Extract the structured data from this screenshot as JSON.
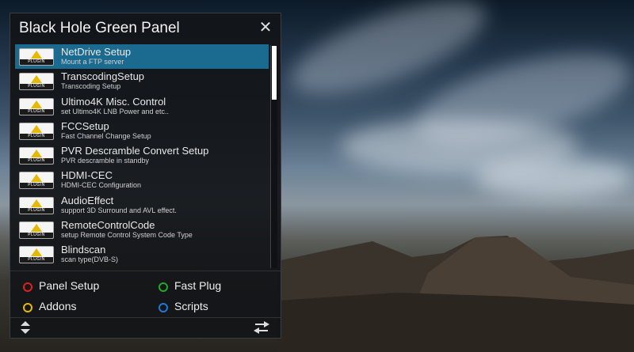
{
  "panel": {
    "title": "Black Hole Green Panel",
    "close_icon": "close-icon"
  },
  "items": [
    {
      "title": "NetDrive Setup",
      "subtitle": "Mount a FTP server",
      "selected": true
    },
    {
      "title": "TranscodingSetup",
      "subtitle": "Transcoding Setup",
      "selected": false
    },
    {
      "title": "Ultimo4K Misc. Control",
      "subtitle": "set Ultimo4K LNB Power and etc..",
      "selected": false
    },
    {
      "title": "FCCSetup",
      "subtitle": "Fast Channel Change Setup",
      "selected": false
    },
    {
      "title": "PVR Descramble Convert Setup",
      "subtitle": "PVR descramble in standby",
      "selected": false
    },
    {
      "title": "HDMI-CEC",
      "subtitle": "HDMI-CEC Configuration",
      "selected": false
    },
    {
      "title": "AudioEffect",
      "subtitle": "support 3D Surround and AVL effect.",
      "selected": false
    },
    {
      "title": "RemoteControlCode",
      "subtitle": "setup Remote Control System Code Type",
      "selected": false
    },
    {
      "title": "Blindscan",
      "subtitle": "scan type(DVB-S)",
      "selected": false
    }
  ],
  "plugin_icon_text": "PLUGIN",
  "legend": {
    "red": {
      "label": "Panel Setup",
      "color": "#e02020"
    },
    "green": {
      "label": "Fast Plug",
      "color": "#1faa2a"
    },
    "yellow": {
      "label": "Addons",
      "color": "#e6b800"
    },
    "blue": {
      "label": "Scripts",
      "color": "#1e78d8"
    }
  },
  "colors": {
    "selection": "#1a6b8f",
    "panel_bg": "#121418"
  },
  "footer": {
    "left_icon": "up-down-arrows-icon",
    "right_icon": "swap-arrows-icon"
  }
}
